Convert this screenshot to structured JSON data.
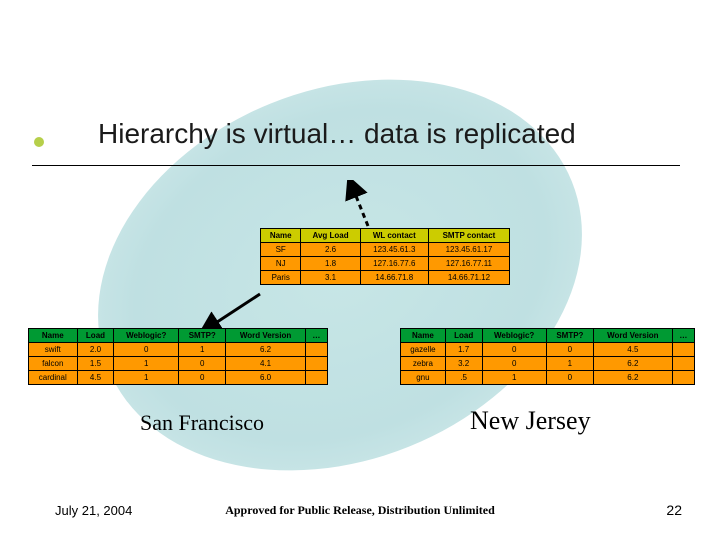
{
  "title": "Hierarchy is virtual… data is replicated",
  "top_table": {
    "headers": [
      "Name",
      "Avg Load",
      "WL contact",
      "SMTP contact"
    ],
    "rows": [
      [
        "SF",
        "2.6",
        "123.45.61.3",
        "123.45.61.17"
      ],
      [
        "NJ",
        "1.8",
        "127.16.77.6",
        "127.16.77.11"
      ],
      [
        "Paris",
        "3.1",
        "14.66.71.8",
        "14.66.71.12"
      ]
    ]
  },
  "left_table": {
    "headers": [
      "Name",
      "Load",
      "Weblogic?",
      "SMTP?",
      "Word Version",
      "…"
    ],
    "rows": [
      [
        "swift",
        "2.0",
        "0",
        "1",
        "6.2",
        ""
      ],
      [
        "falcon",
        "1.5",
        "1",
        "0",
        "4.1",
        ""
      ],
      [
        "cardinal",
        "4.5",
        "1",
        "0",
        "6.0",
        ""
      ]
    ]
  },
  "right_table": {
    "headers": [
      "Name",
      "Load",
      "Weblogic?",
      "SMTP?",
      "Word Version",
      "…"
    ],
    "rows": [
      [
        "gazelle",
        "1.7",
        "0",
        "0",
        "4.5",
        ""
      ],
      [
        "zebra",
        "3.2",
        "0",
        "1",
        "6.2",
        ""
      ],
      [
        "gnu",
        ".5",
        "1",
        "0",
        "6.2",
        ""
      ]
    ]
  },
  "captions": {
    "sf": "San Francisco",
    "nj": "New Jersey"
  },
  "footer": {
    "date": "July 21, 2004",
    "center": "Approved for Public Release, Distribution Unlimited",
    "page": "22"
  }
}
